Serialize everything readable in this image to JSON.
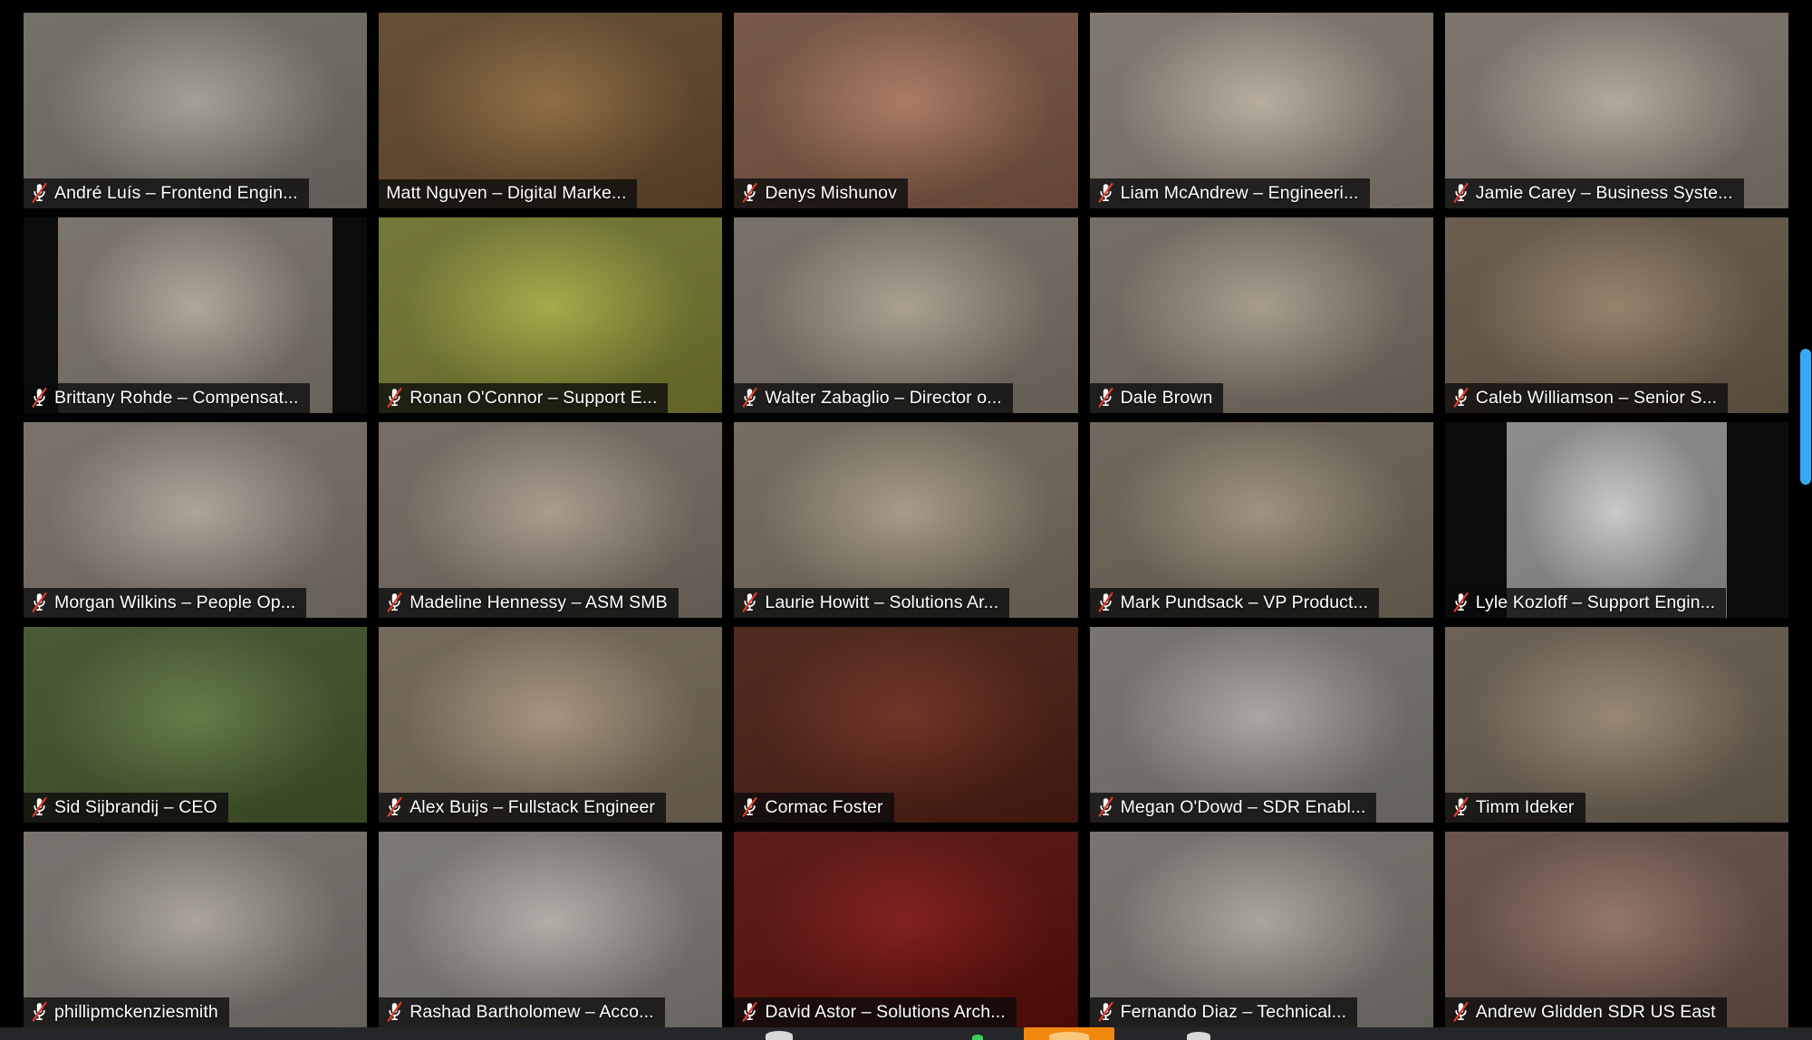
{
  "app": {
    "title": "Zoom Meeting — Gallery View",
    "view": "gallery",
    "grid": {
      "columns": 5,
      "rows": 5,
      "visible_tiles": 25
    },
    "active_speaker_border_color": "#c9e95c",
    "scrollbar_color": "#36a9f4"
  },
  "icons": {
    "muted_mic": "mic-muted-icon",
    "mic_slash_color": "#e03a2f",
    "mic_body_color": "#ffffff"
  },
  "toolbar": {
    "background": "#242629",
    "share_screen_color": "#f2870d",
    "items": [
      {
        "name": "mute-button",
        "label": ""
      },
      {
        "name": "start-video-button",
        "label": ""
      },
      {
        "name": "share-screen-button",
        "label": ""
      },
      {
        "name": "participants-button",
        "label": ""
      }
    ]
  },
  "participants": [
    {
      "name": "André Luís – Frontend Engin...",
      "muted": true,
      "active": false,
      "bg": "#c9c3b8",
      "fit": "cover",
      "row": 1,
      "col": 1
    },
    {
      "name": "Matt Nguyen – Digital Marke...",
      "muted": false,
      "active": false,
      "bg": "#b08a5c",
      "fit": "cover",
      "row": 1,
      "col": 2
    },
    {
      "name": "Denys Mishunov",
      "muted": true,
      "active": false,
      "bg": "#cf9a7e",
      "fit": "cover",
      "row": 1,
      "col": 3
    },
    {
      "name": "Liam McAndrew – Engineeri...",
      "muted": true,
      "active": true,
      "bg": "#ded2c2",
      "fit": "cover",
      "row": 1,
      "col": 4
    },
    {
      "name": "Jamie Carey – Business Syste...",
      "muted": true,
      "active": false,
      "bg": "#d8cdbe",
      "fit": "cover",
      "row": 1,
      "col": 5
    },
    {
      "name": "Brittany Rohde – Compensat...",
      "muted": true,
      "active": false,
      "bg": "#d5cbbd",
      "fit": "pillar",
      "row": 2,
      "col": 1
    },
    {
      "name": "Ronan O'Connor – Support E...",
      "muted": true,
      "active": false,
      "bg": "#c9cf62",
      "fit": "cover",
      "row": 2,
      "col": 2
    },
    {
      "name": "Walter Zabaglio – Director o...",
      "muted": true,
      "active": false,
      "bg": "#cfc3b2",
      "fit": "cover",
      "row": 2,
      "col": 3
    },
    {
      "name": "Dale Brown",
      "muted": true,
      "active": false,
      "bg": "#cbbfae",
      "fit": "cover",
      "row": 2,
      "col": 4
    },
    {
      "name": "Caleb Williamson –  Senior S...",
      "muted": true,
      "active": false,
      "bg": "#b7a289",
      "fit": "cover",
      "row": 2,
      "col": 5
    },
    {
      "name": "Morgan Wilkins – People Op...",
      "muted": true,
      "active": false,
      "bg": "#d3c7bb",
      "fit": "cover",
      "row": 3,
      "col": 1
    },
    {
      "name": "Madeline Hennessy – ASM SMB",
      "muted": true,
      "active": false,
      "bg": "#cdbfae",
      "fit": "cover",
      "row": 3,
      "col": 2
    },
    {
      "name": "Laurie Howitt – Solutions Ar...",
      "muted": true,
      "active": false,
      "bg": "#cbbda8",
      "fit": "cover",
      "row": 3,
      "col": 3
    },
    {
      "name": "Mark Pundsack – VP Product...",
      "muted": true,
      "active": false,
      "bg": "#c2b49f",
      "fit": "cover",
      "row": 3,
      "col": 4
    },
    {
      "name": "Lyle Kozloff – Support Engin...",
      "muted": true,
      "active": false,
      "bg": "#f2f2f2",
      "fit": "pillar-wide",
      "row": 3,
      "col": 5
    },
    {
      "name": "Sid Sijbrandij – CEO",
      "muted": true,
      "active": false,
      "bg": "#7f9a5e",
      "fit": "cover",
      "row": 4,
      "col": 1
    },
    {
      "name": "Alex Buijs – Fullstack Engineer",
      "muted": true,
      "active": false,
      "bg": "#c9b79e",
      "fit": "cover",
      "row": 4,
      "col": 2
    },
    {
      "name": "Cormac Foster",
      "muted": true,
      "active": false,
      "bg": "#8d4a3a",
      "fit": "cover",
      "row": 4,
      "col": 3
    },
    {
      "name": "Megan O'Dowd – SDR Enabl...",
      "muted": true,
      "active": false,
      "bg": "#cfcac4",
      "fit": "cover",
      "row": 4,
      "col": 4
    },
    {
      "name": "Timm Ideker",
      "muted": true,
      "active": false,
      "bg": "#b9a892",
      "fit": "cover",
      "row": 4,
      "col": 5
    },
    {
      "name": "phillipmckenziesmith",
      "muted": true,
      "active": false,
      "bg": "#cfc8be",
      "fit": "cover",
      "row": 5,
      "col": 1
    },
    {
      "name": "Rashad Bartholomew – Acco...",
      "muted": true,
      "active": false,
      "bg": "#d7d2cb",
      "fit": "cover",
      "row": 5,
      "col": 2
    },
    {
      "name": "David Astor – Solutions Arch...",
      "muted": true,
      "active": false,
      "bg": "#a0332f",
      "fit": "cover",
      "row": 5,
      "col": 3
    },
    {
      "name": "Fernando Diaz – Technical...",
      "muted": true,
      "active": false,
      "bg": "#cfc9c0",
      "fit": "cover",
      "row": 5,
      "col": 4
    },
    {
      "name": "Andrew Glidden SDR US East",
      "muted": true,
      "active": false,
      "bg": "#b49486",
      "fit": "cover",
      "row": 5,
      "col": 5
    }
  ]
}
